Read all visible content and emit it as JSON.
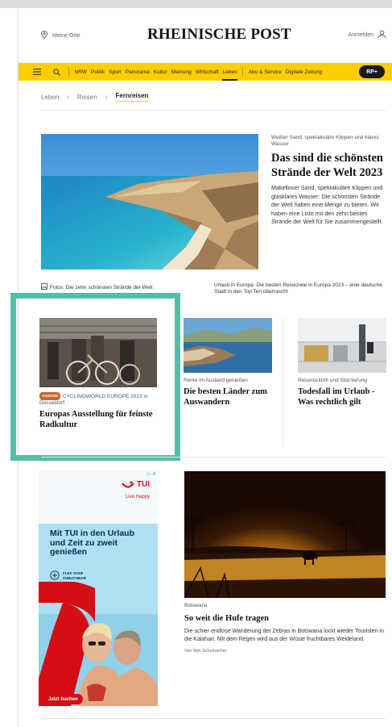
{
  "header": {
    "my_places": "Meine Orte",
    "logo": "RHEINISCHE POST",
    "login": "Anmelden"
  },
  "nav": {
    "items": [
      "NRW",
      "Politik",
      "Sport",
      "Panorama",
      "Kultur",
      "Meinung",
      "Wirtschaft",
      "Leben"
    ],
    "items_right": [
      "Abo & Service",
      "Digitale Zeitung"
    ],
    "active": "Leben",
    "rp_plus": "RP+"
  },
  "breadcrumb": {
    "items": [
      "Leben",
      "Reisen"
    ],
    "current": "Fernreisen"
  },
  "hero": {
    "kicker": "Weißer Sand, spektakuläre Klippen und klares Wasser",
    "title": "Das sind die schönsten Strände der Welt 2023",
    "teaser": "Makelloser Sand, spektakuläre Klippen und glasklares Wasser: Die schönsten Strände der Welt haben eine Menge zu bieten. Wir haben eine Liste mit den zehn besten Strände der Welt für Sie zusammengestellt."
  },
  "related": {
    "fotos": "Fotos: Die zehn schönsten Strände der Welt",
    "link": "Urlaub in Europa: Die besten Reiseziele in Europa 2023 – eine deutsche Stadt in den Top Ten überrascht"
  },
  "cards": [
    {
      "badge": "ANZEIGE",
      "kicker": "CYCLINGWORLD EUROPE 2023 in Düsseldorf",
      "title": "Europas Ausstellung für feinste Radkultur"
    },
    {
      "kicker": "Rente im Ausland genießen",
      "title": "Die besten Länder zum Auswandern"
    },
    {
      "kicker": "Reiserücktritt und Stornierung",
      "title": "Todesfall im Urlaub - Was rechtlich gilt"
    }
  ],
  "ad": {
    "adchoices": "▷ ✕",
    "brand": "TUI",
    "slogan": "Live Happy",
    "headline": "Mit TUI in den Urlaub und Zeit zu zweit genießen",
    "flex": "FLEX TARIF\nZUBUCHBAR",
    "cta": "Jetzt buchen"
  },
  "bottom_article": {
    "kicker": "Botswana",
    "title": "So weit die Hufe tragen",
    "teaser": "Die schier endlose Wanderung der Zebras in Botswana lockt wieder Touristen in die Kalahari. Mit dem Regen wird aus der Wüste fruchtbares Weideland.",
    "author": "Von Win Schumacher"
  },
  "colors": {
    "nav_bg": "#ffce00",
    "highlight": "#52bfa6",
    "tui_red": "#d40e14"
  }
}
